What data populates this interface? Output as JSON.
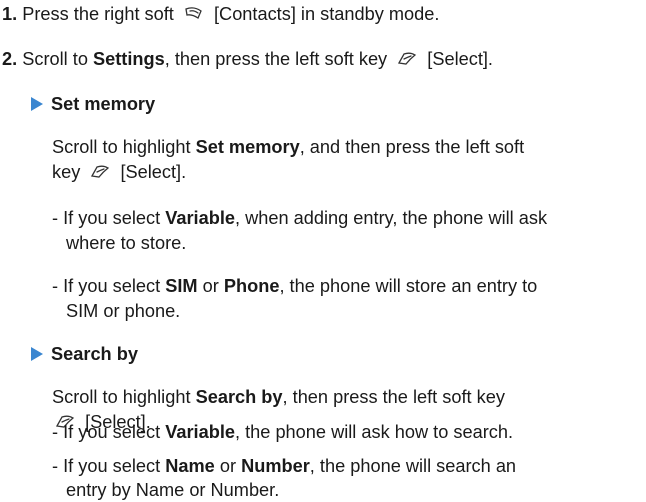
{
  "step1": {
    "num": "1.",
    "pre": "Press the right soft",
    "post": "[Contacts] in standby mode."
  },
  "step2": {
    "num": "2.",
    "pre": "Scroll to",
    "bold": "Settings",
    "mid": ", then press the left soft key",
    "post": "[Select]."
  },
  "set_memory": {
    "header": "Set memory",
    "p1a": "Scroll to highlight",
    "p1b": "Set memory",
    "p1c": ", and then press the left soft",
    "p1d": "key",
    "p1e": "[Select].",
    "b1_pre": "- If you select",
    "b1_bold": "Variable",
    "b1_post": ", when adding entry, the phone will ask",
    "b1_line2": "where to store.",
    "b2_pre": "- If you select",
    "b2_bold1": "SIM",
    "b2_or": "or",
    "b2_bold2": "Phone",
    "b2_post": ", the phone will store an entry to",
    "b2_line2": "SIM or phone."
  },
  "search_by": {
    "header": "Search by",
    "p1a": "Scroll to highlight",
    "p1b": "Search by",
    "p1c": ", then press the left soft key",
    "p1d": "[Select].",
    "b1_pre": "- If you select",
    "b1_bold": "Variable",
    "b1_post": ", the phone will ask how to search.",
    "b2_pre": "- If you select",
    "b2_bold1": "Name",
    "b2_or": "or",
    "b2_bold2": "Number",
    "b2_post": ", the phone will search an",
    "b2_line2": "entry by Name or Number."
  },
  "icons": {
    "right_soft_key": "right-soft-key-icon",
    "left_soft_key": "left-soft-key-icon",
    "section_marker": "blue-triangle-icon"
  },
  "colors": {
    "text": "#1a1a1a",
    "triangle": "#3a86d0"
  }
}
